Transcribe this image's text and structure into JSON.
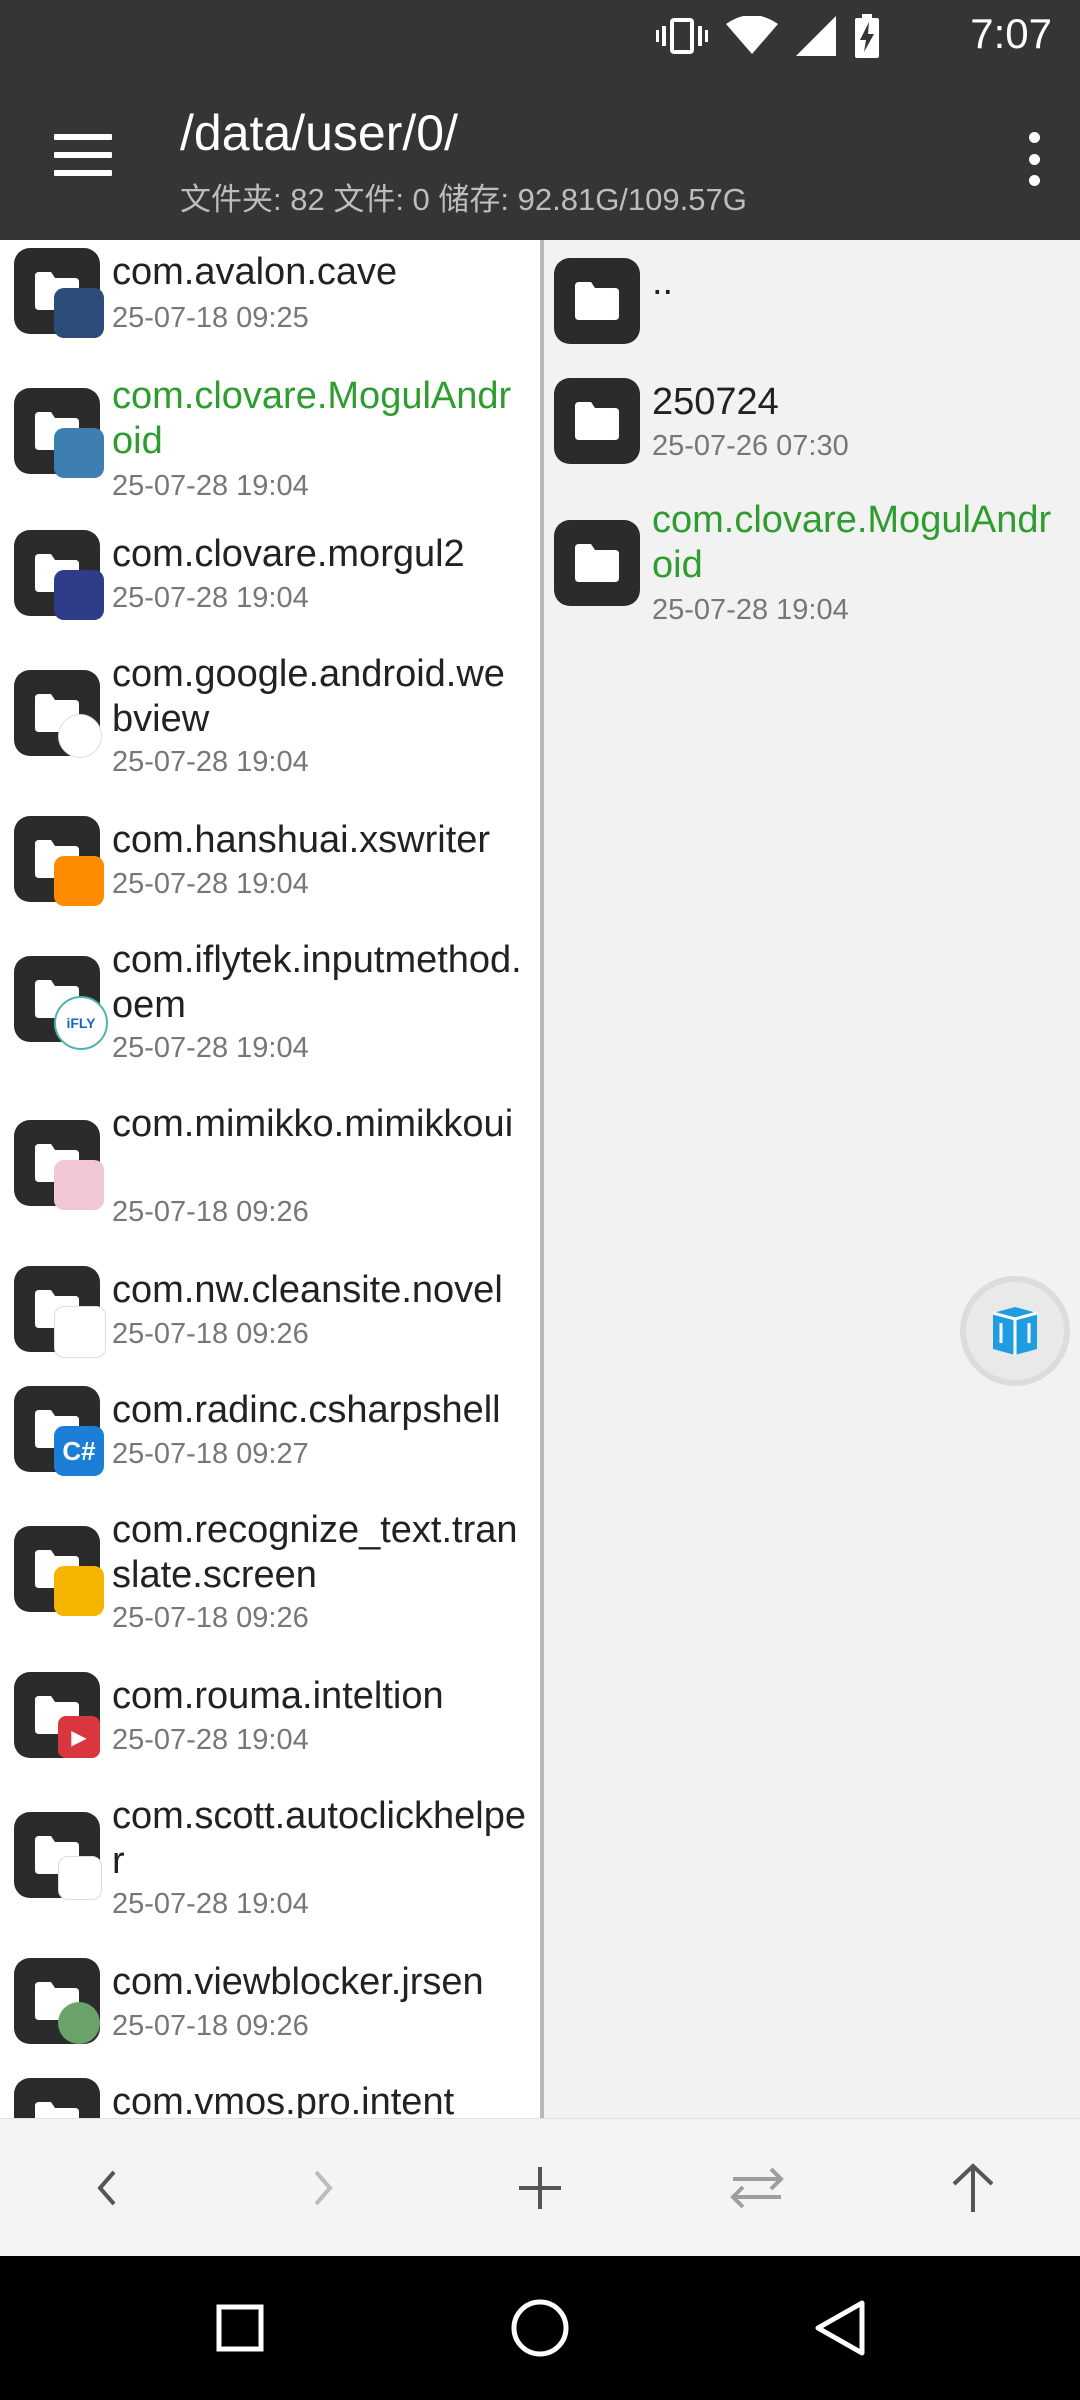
{
  "status": {
    "time": "7:07"
  },
  "appbar": {
    "title": "/data/user/0/",
    "subtitle": "文件夹: 82  文件: 0  储存: 92.81G/109.57G"
  },
  "left_pane": {
    "items": [
      {
        "name": "com.avalon.cave",
        "date": "25-07-18 09:25",
        "badge_color": "#2c4d7a",
        "badge_text": ""
      },
      {
        "name": "com.clovare.MogulAndroid",
        "date": "25-07-28 19:04",
        "badge_color": "#3d7fb0",
        "badge_text": "",
        "highlight": true
      },
      {
        "name": "com.clovare.morgul2",
        "date": "25-07-28 19:04",
        "badge_color": "#2f3c8a",
        "badge_text": ""
      },
      {
        "name": "com.google.android.webview",
        "date": "25-07-28 19:04",
        "badge_color": "#ffffff",
        "badge_text": ""
      },
      {
        "name": "com.hanshuai.xswriter",
        "date": "25-07-28 19:04",
        "badge_color": "#ff8c00",
        "badge_text": "▼"
      },
      {
        "name": "com.iflytek.inputmethod.oem",
        "date": "25-07-28 19:04",
        "badge_color": "#ffffff",
        "badge_text": "iFLY"
      },
      {
        "name": "com.mimikko.mimikkoui",
        "date": "25-07-18 09:26",
        "badge_color": "#f2c7d4",
        "badge_text": ""
      },
      {
        "name": "com.nw.cleansite.novel",
        "date": "25-07-18 09:26",
        "badge_color": "#ffffff",
        "badge_text": ""
      },
      {
        "name": "com.radinc.csharpshell",
        "date": "25-07-18 09:27",
        "badge_color": "#1b7fd8",
        "badge_text": "C#"
      },
      {
        "name": "com.recognize_text.translate.screen",
        "date": "25-07-18 09:26",
        "badge_color": "#f5b400",
        "badge_text": ""
      },
      {
        "name": "com.rouma.inteltion",
        "date": "25-07-28 19:04",
        "badge_color": "#d9363e",
        "badge_text": "▶"
      },
      {
        "name": "com.scott.autoclickhelper",
        "date": "25-07-28 19:04",
        "badge_color": "#ffffff",
        "badge_text": ""
      },
      {
        "name": "com.viewblocker.jrsen",
        "date": "25-07-18 09:26",
        "badge_color": "#6aa36a",
        "badge_text": ""
      },
      {
        "name": "com.vmos.pro.intent",
        "date": "",
        "badge_color": "#ffffff",
        "badge_text": ""
      }
    ]
  },
  "right_pane": {
    "items": [
      {
        "name": "..",
        "date": ""
      },
      {
        "name": "250724",
        "date": "25-07-26 07:30"
      },
      {
        "name": "com.clovare.MogulAndroid",
        "date": "25-07-28 19:04",
        "highlight": true
      }
    ]
  },
  "toolbar": {
    "buttons": [
      "back",
      "forward",
      "add",
      "swap",
      "up"
    ]
  },
  "colors": {
    "bar_background": "#353535",
    "highlight_green": "#2e9c2e",
    "folder_tile": "#2b2b2b"
  }
}
